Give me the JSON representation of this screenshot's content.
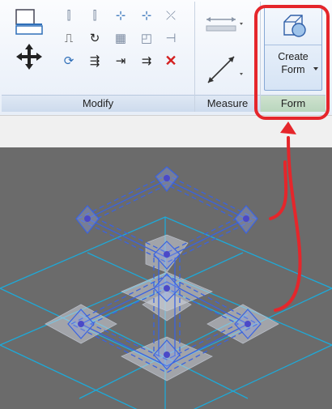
{
  "ribbon": {
    "panels": [
      {
        "id": "modify",
        "label": "Modify"
      },
      {
        "id": "measure",
        "label": "Measure"
      },
      {
        "id": "form",
        "label": "Form"
      }
    ],
    "create_form": {
      "line1": "Create",
      "line2": "Form"
    }
  },
  "icons": {
    "align": "align-icon",
    "move": "move-icon",
    "mirror": "mirror-icon",
    "copy": "copy-icon",
    "rotate": "rotate-icon",
    "array": "array-icon",
    "scale": "scale-icon",
    "pin": "pin-icon",
    "split": "split-icon",
    "trim": "trim-icon",
    "delete": "delete-icon",
    "offset": "offset-icon",
    "measure_aligned": "measure-aligned-icon",
    "measure_diagonal": "measure-diagonal-icon",
    "create_form": "create-form-icon"
  },
  "colors": {
    "accent": "#e5262b",
    "form_blue": "#3a63e0",
    "grid": "#1ea9d8",
    "viewport_bg": "#6b6b6b"
  }
}
